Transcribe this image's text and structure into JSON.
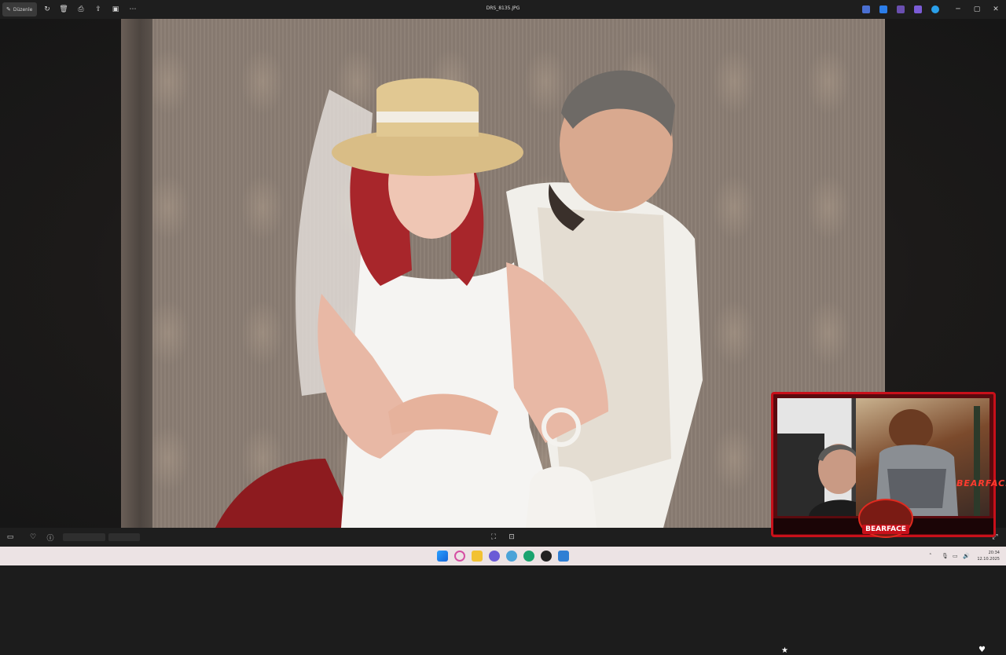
{
  "titlebar": {
    "edit_label": "Düzenle",
    "file_name": "DRS_8135.JPG"
  },
  "icons": {
    "edit": "edit-icon",
    "rotate": "rotate-icon",
    "delete": "trash-icon",
    "print": "print-icon",
    "share": "share-icon",
    "crop": "crop-icon",
    "more": "more-icon",
    "minimize": "minimize-icon",
    "maximize": "maximize-icon",
    "close": "close-icon"
  },
  "webcam": {
    "brand": "BEARFACE",
    "badge": "BEARFACE"
  },
  "taskbar": {
    "time": "20:34",
    "date": "12.10.2025"
  },
  "colors": {
    "accent": "#c8101a",
    "windows_blue": "#1e7cd6"
  }
}
